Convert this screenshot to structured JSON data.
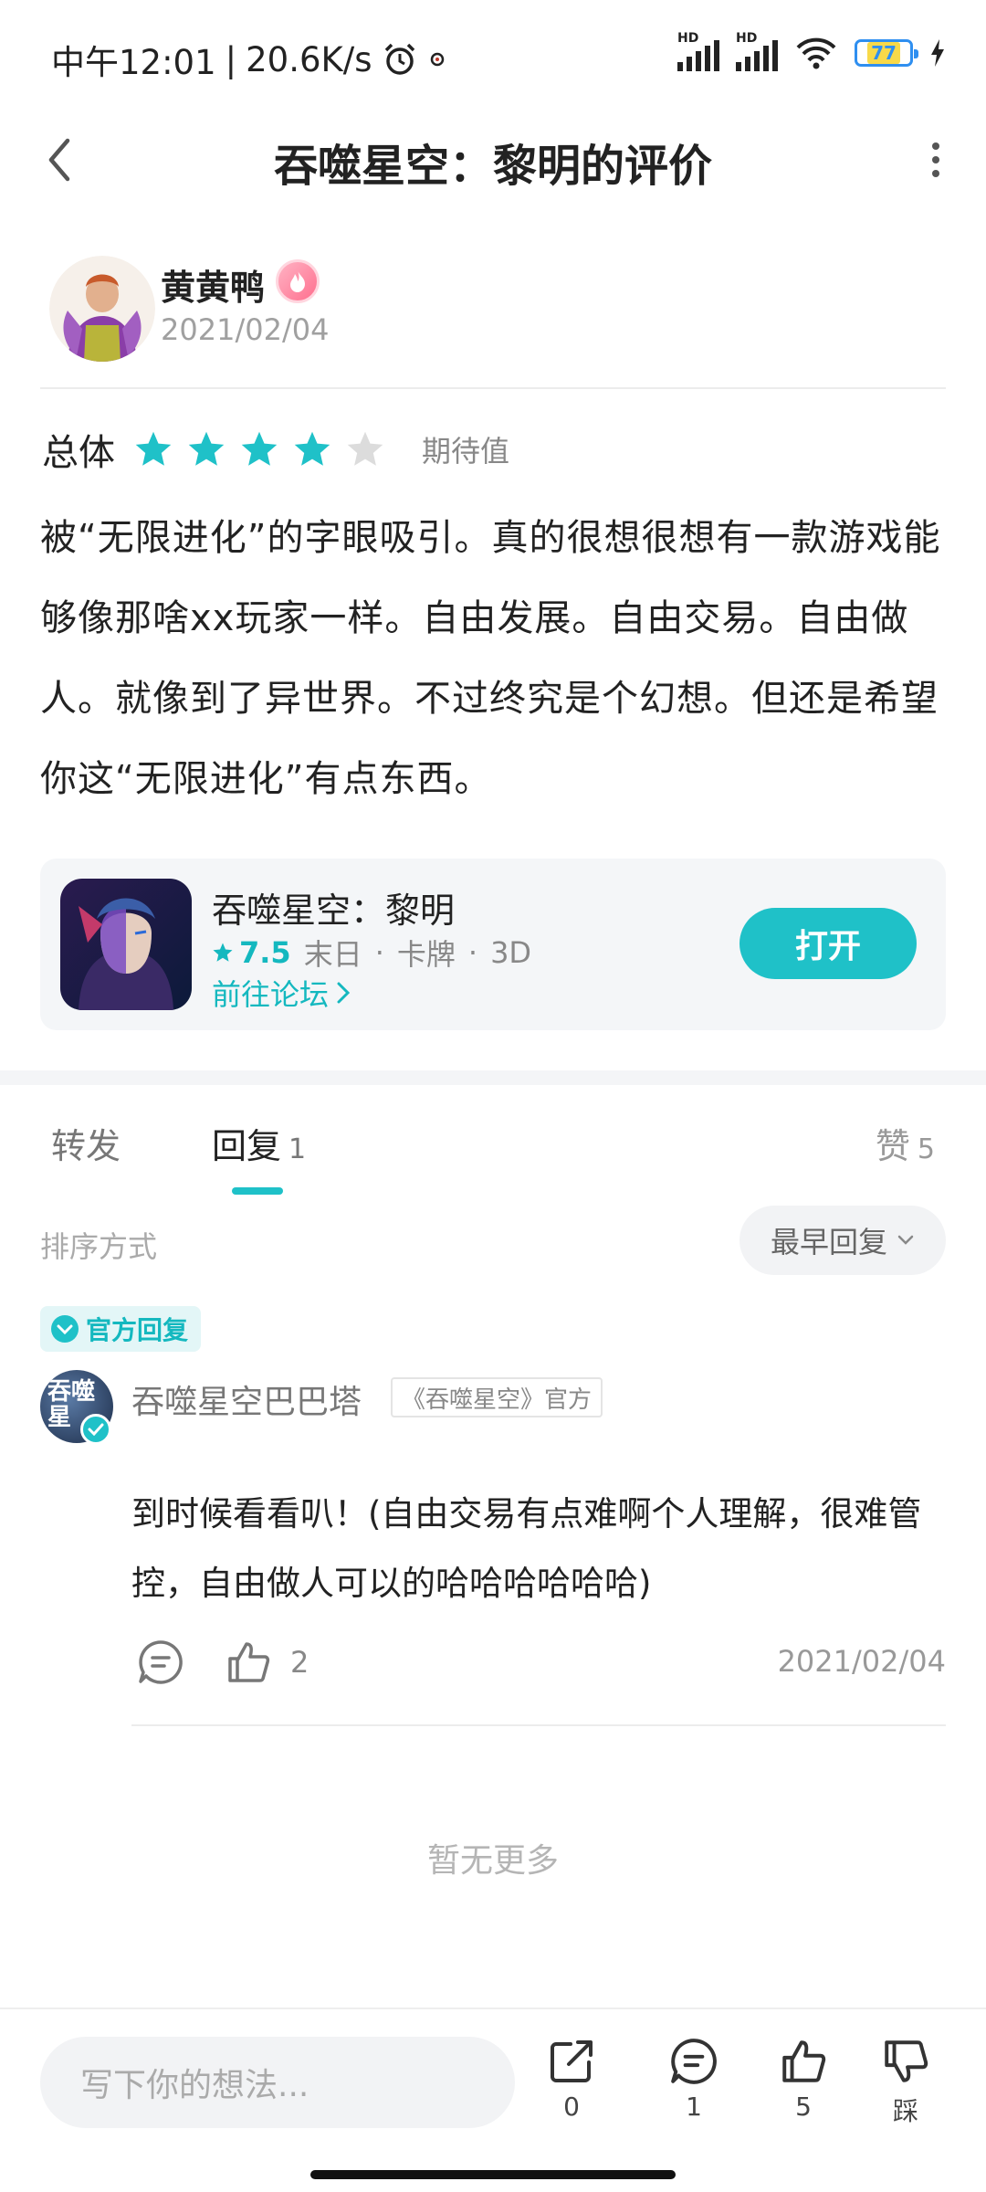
{
  "status_bar": {
    "time": "中午12:01",
    "speed": "20.6K/s",
    "battery": "77",
    "signal_label": "HD"
  },
  "header": {
    "title": "吞噬星空：黎明的评价"
  },
  "author": {
    "name": "黄黄鸭",
    "date": "2021/02/04"
  },
  "rating": {
    "label": "总体",
    "stars": 4,
    "max_stars": 5,
    "tag": "期待值"
  },
  "review": {
    "text": "被“无限进化”的字眼吸引。真的很想很想有一款游戏能够像那啥xx玩家一样。自由发展。自由交易。自由做人。就像到了异世界。不过终究是个幻想。但还是希望你这“无限进化”有点东西。"
  },
  "game_card": {
    "name": "吞噬星空：黎明",
    "score": "7.5",
    "tags": [
      "末日",
      "卡牌",
      "3D"
    ],
    "separator": "·",
    "forum_link": "前往论坛",
    "open_button": "打开"
  },
  "tabs": {
    "forward": "转发",
    "reply": "回复",
    "reply_count": "1",
    "like": "赞",
    "like_count": "5"
  },
  "sort": {
    "label": "排序方式",
    "value": "最早回复"
  },
  "reply": {
    "official_tag": "官方回复",
    "author": "吞噬星空巴巴塔",
    "avatar_text": "吞噬星",
    "source": "《吞噬星空》官方",
    "text": "到时候看看叭！(自由交易有点难啊个人理解，很难管控，自由做人可以的哈哈哈哈哈哈)",
    "likes": "2",
    "date": "2021/02/04"
  },
  "no_more": "暂无更多",
  "bottom_bar": {
    "input_placeholder": "写下你的想法...",
    "share_count": "0",
    "comment_count": "1",
    "like_count": "5",
    "dislike_label": "踩"
  },
  "colors": {
    "accent": "#1fc1c8",
    "star_empty": "#dcdcdc"
  }
}
